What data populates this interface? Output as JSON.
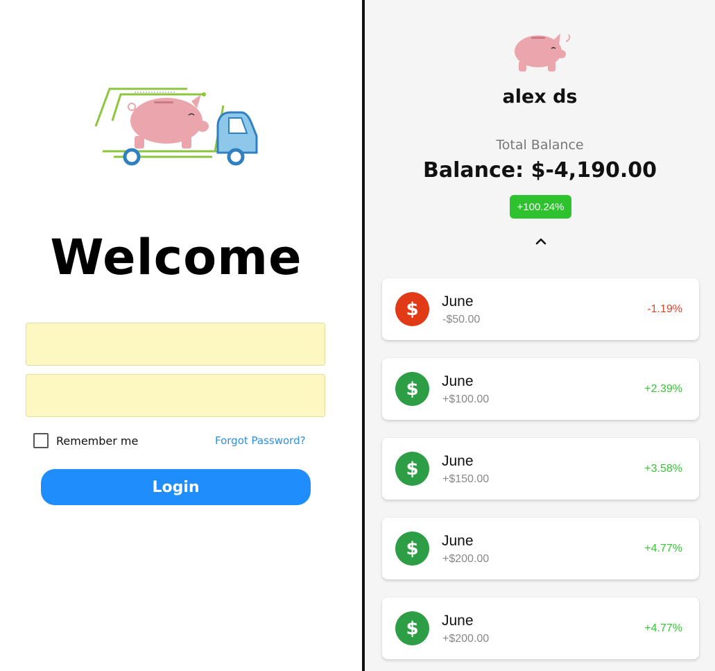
{
  "login": {
    "welcome": "Welcome",
    "username_placeholder": "",
    "password_placeholder": "",
    "remember_label": "Remember me",
    "forgot_label": "Forgot Password?",
    "login_label": "Login",
    "logo_icon": "piggy-bank-truck-logo"
  },
  "profile": {
    "avatar_icon": "piggy-bank-icon",
    "username": "alex ds",
    "total_label": "Total Balance",
    "balance_text": "Balance: $-4,190.00",
    "change_badge": "+100.24%",
    "toggle_icon": "chevron-up-icon"
  },
  "transactions": [
    {
      "title": "June",
      "amount": "-$50.00",
      "change": "-1.19%",
      "trend": "negative",
      "coin_symbol": "$"
    },
    {
      "title": "June",
      "amount": "+$100.00",
      "change": "+2.39%",
      "trend": "positive",
      "coin_symbol": "$"
    },
    {
      "title": "June",
      "amount": "+$150.00",
      "change": "+3.58%",
      "trend": "positive",
      "coin_symbol": "$"
    },
    {
      "title": "June",
      "amount": "+$200.00",
      "change": "+4.77%",
      "trend": "positive",
      "coin_symbol": "$"
    },
    {
      "title": "June",
      "amount": "+$200.00",
      "change": "+4.77%",
      "trend": "positive",
      "coin_symbol": "$"
    }
  ],
  "colors": {
    "input_bg": "#fdf8c2",
    "login_button": "#1f8dfb",
    "link": "#2e8fe2",
    "badge_green": "#2fc22f",
    "coin_red": "#e13a16",
    "coin_green": "#2e9e46",
    "negative_text": "#d9442b",
    "positive_text": "#36c536"
  }
}
